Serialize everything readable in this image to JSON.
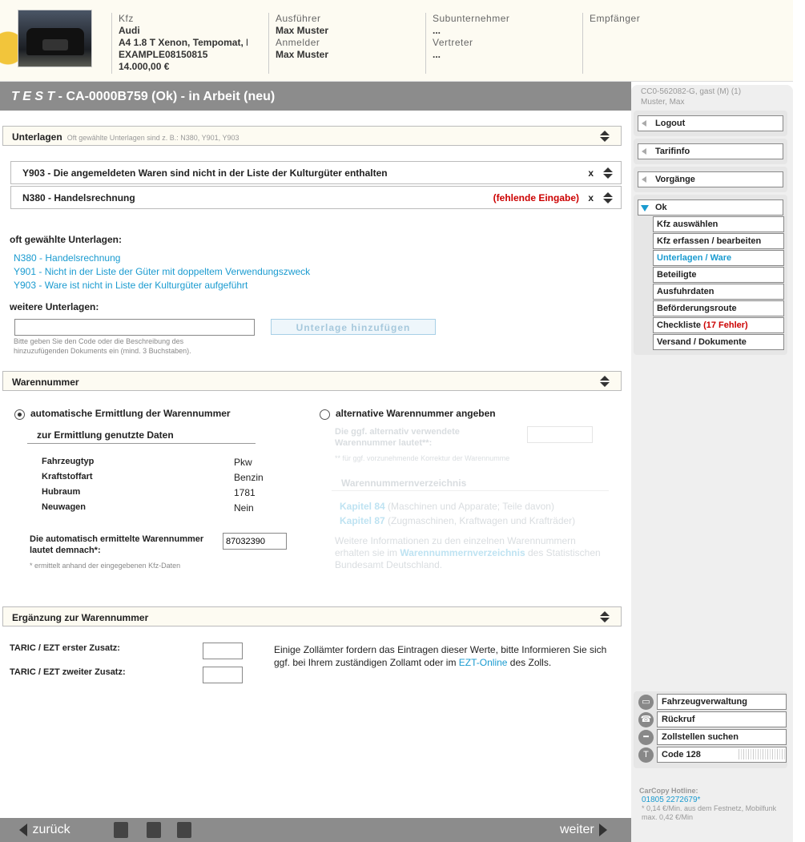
{
  "header": {
    "kfz": {
      "label": "Kfz",
      "make": "Audi",
      "model": "A4 1.8 T Xenon, Tempomat, I",
      "vin": "EXAMPLE08150815",
      "price": "14.000,00 €"
    },
    "ausfuehrer": {
      "label": "Ausführer",
      "value": "Max Muster"
    },
    "anmelder": {
      "label": "Anmelder",
      "value": "Max Muster"
    },
    "subunternehmer": {
      "label": "Subunternehmer",
      "value": "..."
    },
    "vertreter": {
      "label": "Vertreter",
      "value": "..."
    },
    "empfaenger": {
      "label": "Empfänger"
    }
  },
  "title": {
    "test": "T E S T",
    "rest": " - CA-0000B759 (Ok) - in Arbeit (neu)"
  },
  "unterlagen": {
    "heading": "Unterlagen",
    "hint": "Oft gewählte Unterlagen sind z. B.: N380, Y901, Y903",
    "docs": [
      {
        "label": "Y903 - Die angemeldeten Waren sind nicht in der Liste der Kulturgüter enthalten",
        "remove": "x"
      },
      {
        "label": "N380 - Handelsrechnung",
        "missing": "(fehlende Eingabe)",
        "remove": "x"
      }
    ],
    "often_label": "oft gewählte Unterlagen:",
    "often": [
      "N380 - Handelsrechnung",
      "Y901 - Nicht in der Liste der Güter mit doppeltem Verwendungszweck",
      "Y903 - Ware ist nicht in Liste der Kulturgüter aufgeführt"
    ],
    "more_label": "weitere Unterlagen:",
    "add_button": "Unterlage hinzufügen",
    "help1": "Bitte geben Sie den Code oder die Beschreibung des",
    "help2": "hinzuzufügenden Dokuments ein (mind. 3 Buchstaben)."
  },
  "warennummer": {
    "heading": "Warennummer",
    "auto_label": "automatische Ermittlung der Warennummer",
    "alt_label": "alternative Warennummer angeben",
    "data_heading": "zur Ermittlung genutzte Daten",
    "rows": [
      {
        "k": "Fahrzeugtyp",
        "v": "Pkw"
      },
      {
        "k": "Kraftstoffart",
        "v": "Benzin"
      },
      {
        "k": "Hubraum",
        "v": "1781"
      },
      {
        "k": "Neuwagen",
        "v": "Nein"
      }
    ],
    "result_label1": "Die automatisch ermittelte Warennummer",
    "result_label2": "lautet demnach*:",
    "result_value": "87032390",
    "footnote": "* ermittelt anhand der eingegebenen Kfz-Daten",
    "alt_q1": "Die ggf. alternativ verwendete",
    "alt_q2": "Warennummer lautet**:",
    "alt_note": "** für ggf. vorzunehmende Korrektur der Warennumme",
    "verz_heading": "Warennummernverzeichnis",
    "kap84": "Kapitel 84",
    "kap84_desc": " (Maschinen und Apparate; Teile davon)",
    "kap87": "Kapitel 87",
    "kap87_desc": " (Zugmaschinen, Kraftwagen und Krafträder)",
    "info1": "Weitere Informationen zu den einzelnen Warennummern",
    "info2a": "erhalten sie im ",
    "info2_link": "Warennummernverzeichnis",
    "info2b": " des Statistischen",
    "info3": "Bundesamt Deutschland."
  },
  "ergaenzung": {
    "heading": "Ergänzung zur Warennummer",
    "first": "TARIC / EZT erster Zusatz:",
    "second": "TARIC / EZT zweiter Zusatz:",
    "text1": "Einige Zollämter fordern das Eintragen dieser Werte, bitte Informieren Sie sich",
    "text2a": "ggf. bei Ihrem zuständigen Zollamt oder im ",
    "text2_link": "EZT-Online",
    "text2b": " des Zolls."
  },
  "sidebar": {
    "user1": "CC0-562082-G, gast (M) (1)",
    "user2": "Muster, Max",
    "logout": "Logout",
    "tarifinfo": "Tarifinfo",
    "vorgaenge": "Vorgänge",
    "ok": "Ok",
    "subs": [
      "Kfz auswählen",
      "Kfz erfassen / bearbeiten",
      "Unterlagen / Ware",
      "Beteiligte",
      "Ausfuhrdaten",
      "Beförderungsroute"
    ],
    "checkliste": "Checkliste",
    "fehler": "(17 Fehler)",
    "versand": "Versand / Dokumente",
    "tools": [
      "Fahrzeugverwaltung",
      "Rückruf",
      "Zollstellen suchen",
      "Code 128"
    ],
    "hotline_label": "CarCopy Hotline:",
    "hotline_number": "01805 2272679*",
    "hotline_note1": "* 0,14 €/Min. aus dem Festnetz, Mobilfunk",
    "hotline_note2": "max. 0,42 €/Min"
  },
  "footer": {
    "back": "zurück",
    "next": "weiter"
  },
  "colors": {
    "accent": "#1a9bd0",
    "error": "#cc0000",
    "bar": "#8c8c8c"
  }
}
